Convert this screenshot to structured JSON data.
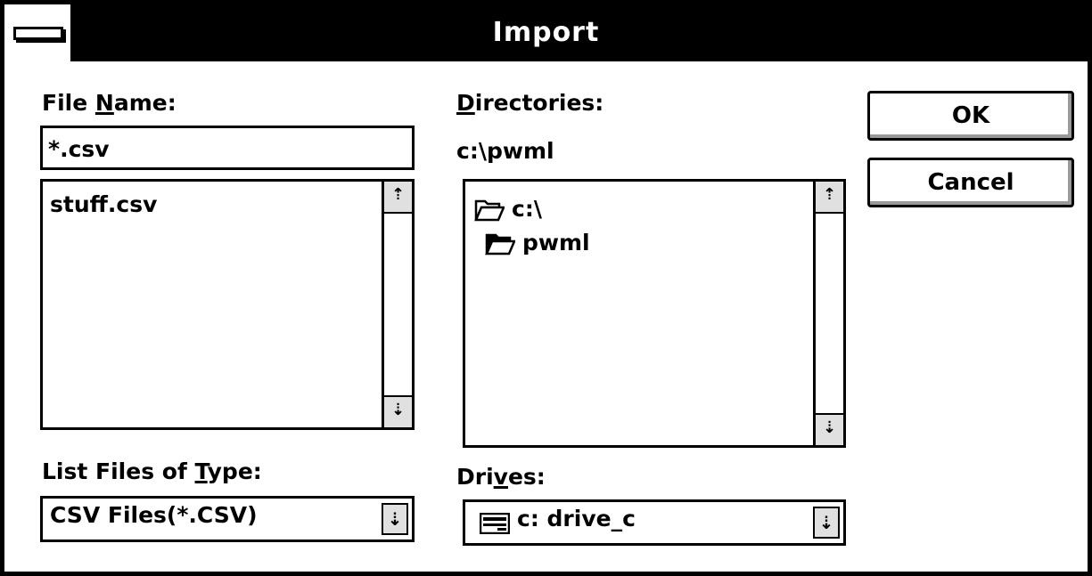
{
  "dialog": {
    "title": "Import"
  },
  "file_name": {
    "label_pre": "File ",
    "label_accel": "N",
    "label_post": "ame:",
    "value": "*.csv",
    "files": [
      "stuff.csv"
    ]
  },
  "directories": {
    "label_accel": "D",
    "label_post": "irectories:",
    "current_path": "c:\\pwml",
    "tree": [
      {
        "label": "c:\\",
        "icon": "open-folder-icon"
      },
      {
        "label": "pwml",
        "icon": "filled-open-folder-icon"
      }
    ]
  },
  "file_type": {
    "label_pre": "List Files of ",
    "label_accel": "T",
    "label_post": "ype:",
    "selected": "CSV Files(*.CSV)"
  },
  "drives": {
    "label_pre": "Dri",
    "label_accel": "v",
    "label_post": "es:",
    "selected": "c: drive_c",
    "icon": "drive-icon"
  },
  "buttons": {
    "ok": "OK",
    "cancel": "Cancel"
  },
  "icons": {
    "scroll_up": "⇡",
    "scroll_down": "⇣",
    "dropdown": "⇣"
  }
}
